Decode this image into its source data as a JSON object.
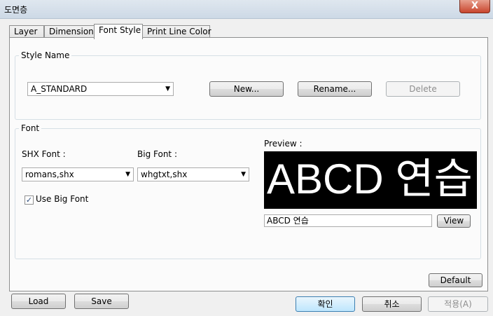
{
  "window": {
    "title": "도면층",
    "close_label": "X"
  },
  "tabs": [
    {
      "label": "Layer"
    },
    {
      "label": "Dimension"
    },
    {
      "label": "Font Style"
    },
    {
      "label": "Print Line Color"
    }
  ],
  "style_name": {
    "legend": "Style Name",
    "selected": "A_STANDARD",
    "new_label": "New...",
    "rename_label": "Rename...",
    "delete_label": "Delete"
  },
  "font": {
    "legend": "Font",
    "shx_label": "SHX Font :",
    "shx_value": "romans,shx",
    "big_label": "Big Font :",
    "big_value": "whgtxt,shx",
    "use_big_font_label": "Use Big Font",
    "use_big_font_checked": true,
    "preview_label": "Preview :",
    "preview_text": "ABCD 연습",
    "preview_input_value": "ABCD 연습",
    "view_label": "View"
  },
  "buttons": {
    "default_label": "Default",
    "load_label": "Load",
    "save_label": "Save",
    "ok_label": "확인",
    "cancel_label": "취소",
    "apply_label": "적용(A)"
  },
  "icons": {
    "dropdown": "chevron-down-icon",
    "check": "checkmark-icon",
    "close": "close-icon"
  }
}
